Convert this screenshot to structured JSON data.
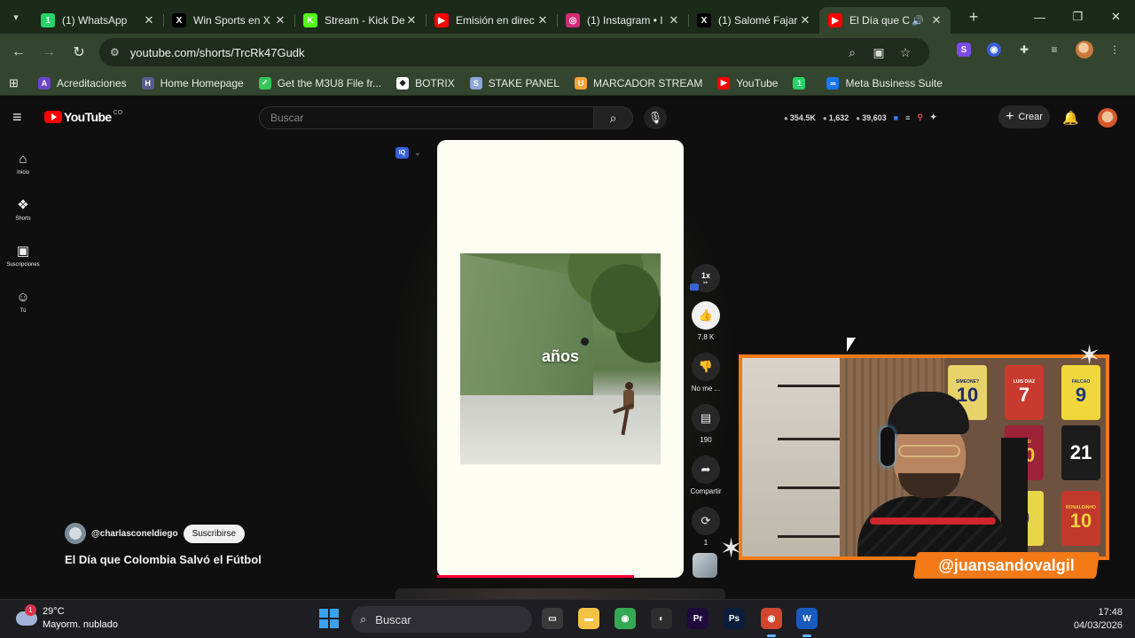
{
  "browser": {
    "tabs": [
      {
        "title": "(1) WhatsApp",
        "icon": "whatsapp-icon",
        "color": "#25d366",
        "glyph": "1"
      },
      {
        "title": "Win Sports en X",
        "icon": "x-icon",
        "color": "#000000",
        "glyph": "X"
      },
      {
        "title": "Stream - Kick De",
        "icon": "kick-icon",
        "color": "#53fc18",
        "glyph": "K"
      },
      {
        "title": "Emisión en direc",
        "icon": "youtube-icon",
        "color": "#ff0000",
        "glyph": "▶"
      },
      {
        "title": "(1) Instagram • I",
        "icon": "instagram-icon",
        "color": "#d62976",
        "glyph": "◎"
      },
      {
        "title": "(1) Salomé Fajar",
        "icon": "x-icon",
        "color": "#000000",
        "glyph": "X"
      },
      {
        "title": "El Día que C",
        "icon": "youtube-icon",
        "color": "#ff0000",
        "glyph": "▶",
        "active": true
      }
    ],
    "url": "youtube.com/shorts/TrcRk47Gudk",
    "bookmarks": [
      {
        "label": "Acreditaciones",
        "color": "#6a45c9",
        "glyph": "A"
      },
      {
        "label": "Home Homepage",
        "color": "#5a5a8a",
        "glyph": "H"
      },
      {
        "label": "Get the M3U8 File fr...",
        "color": "#34c759",
        "glyph": "✓"
      },
      {
        "label": "BOTRIX",
        "color": "#ffffff",
        "glyph": "◆"
      },
      {
        "label": "STAKE PANEL",
        "color": "#8aa6d8",
        "glyph": "S"
      },
      {
        "label": "MARCADOR STREAM",
        "color": "#f2a33a",
        "glyph": "U"
      },
      {
        "label": "YouTube",
        "color": "#ff0000",
        "glyph": "▶"
      },
      {
        "label": "",
        "color": "#25d366",
        "glyph": "1"
      },
      {
        "label": "Meta Business Suite",
        "color": "#1877f2",
        "glyph": "∞"
      }
    ]
  },
  "youtube": {
    "logo_text": "YouTube",
    "country": "CO",
    "search_placeholder": "Buscar",
    "stats": [
      "354.5K",
      "1,632",
      "39,603"
    ],
    "create_label": "Crear",
    "sidenav": [
      {
        "label": "Inicio",
        "icon": "home-icon",
        "glyph": "⌂"
      },
      {
        "label": "Shorts",
        "icon": "shorts-icon",
        "glyph": "❖"
      },
      {
        "label": "Suscripciones",
        "icon": "subscriptions-icon",
        "glyph": "▣"
      },
      {
        "label": "Tú",
        "icon": "user-icon",
        "glyph": "☺"
      }
    ],
    "short": {
      "caption": "años",
      "speed": "1x",
      "progress": 0.8,
      "likes": "7,8 K",
      "dislike_label": "No me ...",
      "comments": "190",
      "share_label": "Compartir",
      "remix_count": "1",
      "channel_handle": "@charlasconeldiego",
      "subscribe_label": "Suscribirse",
      "title": "El Día que Colombia Salvó el Fútbol"
    }
  },
  "overlay": {
    "streamer_handle": "@juansandovalgil",
    "jerseys": [
      {
        "name": "SIMEONE?",
        "number": "10",
        "bg": "#e8d36a",
        "fg": "#1d2a6b"
      },
      {
        "name": "LUIS DIAZ",
        "number": "7",
        "bg": "#c93a2e",
        "fg": "#ffffff"
      },
      {
        "name": "FALCAO",
        "number": "9",
        "bg": "#f1d63c",
        "fg": "#1d3a7a"
      },
      {
        "name": "MESSI",
        "number": "10",
        "bg": "#9c2238",
        "fg": "#f2c53d"
      },
      {
        "name": "",
        "number": "21",
        "bg": "#1c1c1c",
        "fg": "#ffffff"
      },
      {
        "name": "",
        "number": "9",
        "bg": "#e8d54a",
        "fg": "#2a3a7a"
      },
      {
        "name": "RONALDINHO",
        "number": "10",
        "bg": "#c0392b",
        "fg": "#f4d03f"
      }
    ]
  },
  "taskbar": {
    "temperature": "29°C",
    "weather_desc": "Mayorm. nublado",
    "weather_badge": "1",
    "search_label": "Buscar",
    "time": "17:48",
    "date": "04/03/2026",
    "apps": [
      {
        "name": "file-explorer-icon",
        "color": "#3a3a3a",
        "glyph": "▭"
      },
      {
        "name": "folder-icon",
        "color": "#f5c344",
        "glyph": "▬"
      },
      {
        "name": "chrome-icon",
        "color": "#34a853",
        "glyph": "◉"
      },
      {
        "name": "obs-icon",
        "color": "#2d2d2d",
        "glyph": "◐"
      },
      {
        "name": "premiere-icon",
        "color": "#1f0a3c",
        "glyph": "Pr"
      },
      {
        "name": "photoshop-icon",
        "color": "#0a1e3c",
        "glyph": "Ps"
      },
      {
        "name": "chrome-alt-icon",
        "color": "#d1462f",
        "glyph": "◉"
      },
      {
        "name": "word-icon",
        "color": "#185abd",
        "glyph": "W"
      }
    ]
  }
}
